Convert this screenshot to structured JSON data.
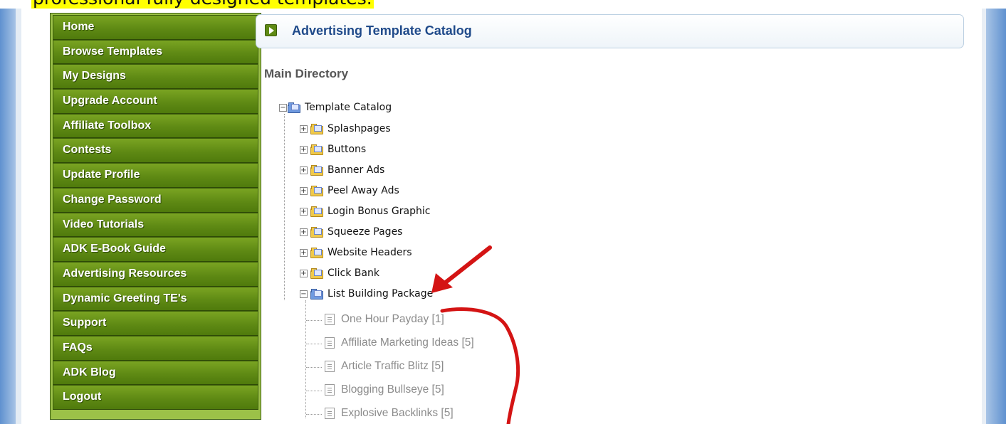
{
  "caption": {
    "text": "professional fully designed templates."
  },
  "nav": {
    "items": [
      "Home",
      "Browse Templates",
      "My Designs",
      "Upgrade Account",
      "Affiliate Toolbox",
      "Contests",
      "Update Profile",
      "Change Password",
      "Video Tutorials",
      "ADK E-Book Guide",
      "Advertising Resources",
      "Dynamic Greeting TE's",
      "Support",
      "FAQs",
      "ADK Blog",
      "Logout"
    ]
  },
  "header": {
    "title": "Advertising Template Catalog"
  },
  "directory": {
    "heading": "Main Directory",
    "root": "Template Catalog",
    "folders": [
      "Splashpages",
      "Buttons",
      "Banner Ads",
      "Peel Away Ads",
      "Login Bonus Graphic",
      "Squeeze Pages",
      "Website Headers",
      "Click Bank",
      "List Building Package"
    ],
    "expanded_folder": "List Building Package",
    "children": [
      "One Hour Payday [1]",
      "Affiliate Marketing Ideas [5]",
      "Article Traffic Blitz [5]",
      "Blogging Bullseye [5]",
      "Explosive Backlinks [5]"
    ]
  },
  "colors": {
    "nav_green": "#5f8a14",
    "title_blue": "#1f4a8a",
    "highlight_yellow": "#ffff00",
    "annotation_red": "#d41414"
  },
  "icons": {
    "collapse": "minus-box-icon",
    "expand": "plus-box-icon",
    "folder": "folder-icon",
    "document": "document-icon"
  }
}
